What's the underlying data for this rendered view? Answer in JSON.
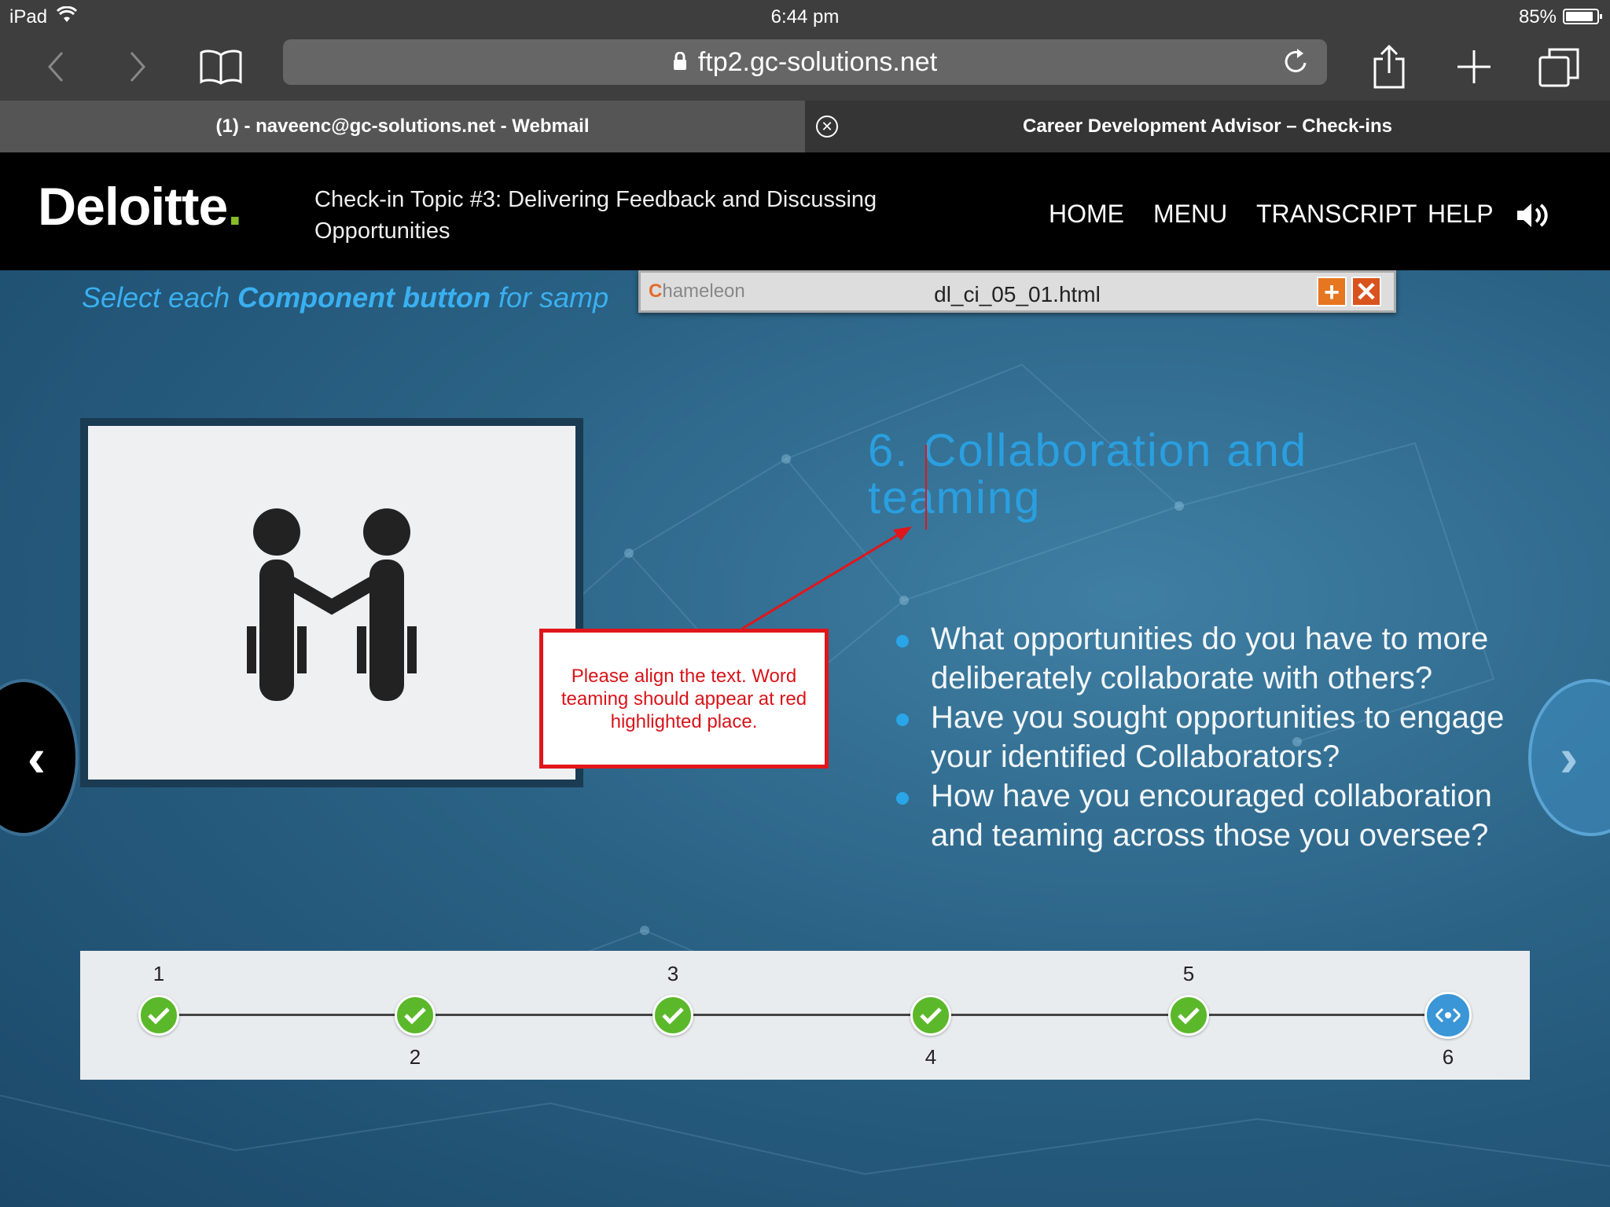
{
  "status_bar": {
    "device": "iPad",
    "time": "6:44 pm",
    "battery": "85%"
  },
  "browser": {
    "url": "ftp2.gc-solutions.net",
    "tabs": [
      {
        "label": "(1) - naveenc@gc-solutions.net - Webmail",
        "active": false
      },
      {
        "label": "Career Development Advisor – Check-ins",
        "active": true
      }
    ]
  },
  "course": {
    "logo": "Deloitte",
    "logo_dot": ".",
    "title": "Check-in Topic #3: Delivering Feedback and Discussing Opportunities",
    "nav": [
      "HOME",
      "MENU",
      "TRANSCRIPT",
      "HELP"
    ]
  },
  "content": {
    "instruction_pre": "Select each ",
    "instruction_bold": "Component button",
    "instruction_post": " for samp",
    "heading": "6. Collaboration and teaming",
    "bullets": [
      "What opportunities do you have to more deliberately collaborate with others?",
      "Have you sought opportunities to engage your identified Collaborators?",
      "How have you encouraged collaboration and teaming across those you oversee?"
    ],
    "annotation": "Please align the text. Word teaming should appear at red highlighted place."
  },
  "chameleon": {
    "brand_first": "C",
    "brand_rest": "hameleon",
    "filename": "dl_ci_05_01.html"
  },
  "progress": {
    "steps": [
      {
        "label": "1",
        "status": "complete"
      },
      {
        "label": "2",
        "status": "complete"
      },
      {
        "label": "3",
        "status": "complete"
      },
      {
        "label": "4",
        "status": "complete"
      },
      {
        "label": "5",
        "status": "complete"
      },
      {
        "label": "6",
        "status": "current"
      }
    ]
  },
  "colors": {
    "brand_green": "#86bc25",
    "heading_blue": "#2a9fe0",
    "annotation_red": "#e0161b",
    "complete_green": "#5cb82b",
    "current_blue": "#3a96d6"
  }
}
